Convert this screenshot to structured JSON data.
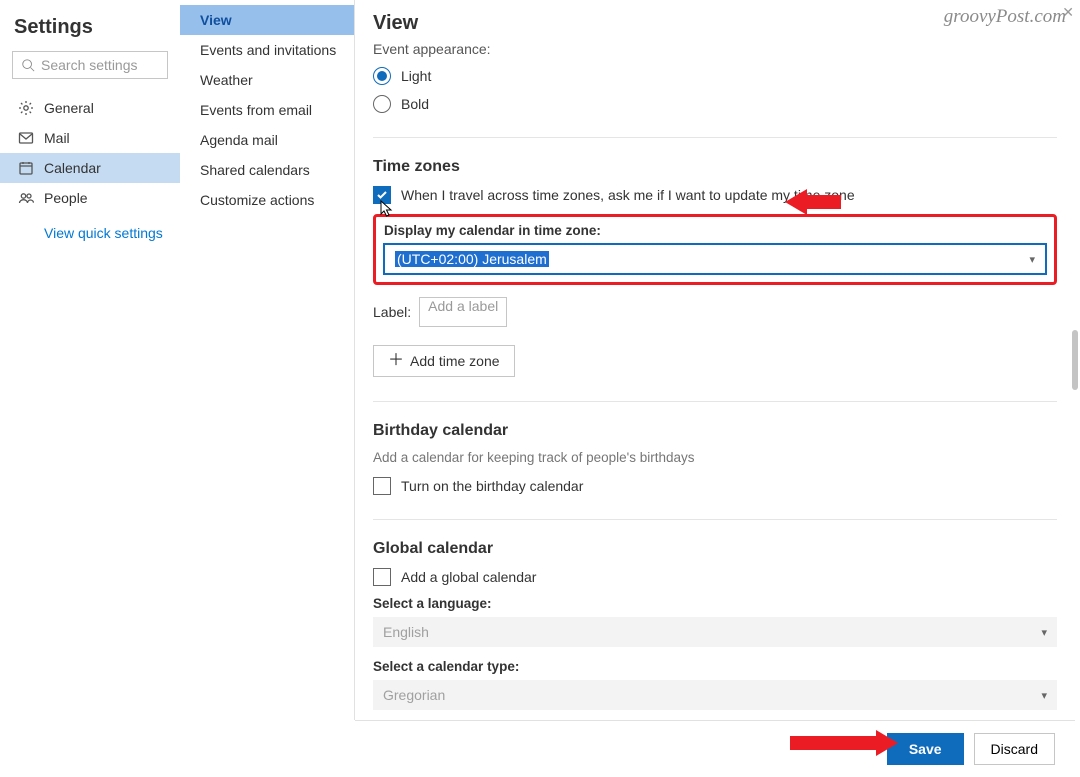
{
  "header": {
    "title": "Settings",
    "watermark": "groovyPost.com"
  },
  "search": {
    "placeholder": "Search settings"
  },
  "nav": {
    "items": [
      {
        "label": "General"
      },
      {
        "label": "Mail"
      },
      {
        "label": "Calendar"
      },
      {
        "label": "People"
      }
    ],
    "quick_link": "View quick settings"
  },
  "tabs": [
    "View",
    "Events and invitations",
    "Weather",
    "Events from email",
    "Agenda mail",
    "Shared calendars",
    "Customize actions"
  ],
  "page": {
    "title": "View",
    "event_appearance": {
      "heading": "Event appearance:",
      "opt_light": "Light",
      "opt_bold": "Bold"
    },
    "timezones": {
      "heading": "Time zones",
      "travel_check": "When I travel across time zones, ask me if I want to update my time zone",
      "display_label": "Display my calendar in time zone:",
      "tz_value": "(UTC+02:00) Jerusalem",
      "label_label": "Label:",
      "label_placeholder": "Add a label",
      "add_btn": "Add time zone"
    },
    "birthday": {
      "heading": "Birthday calendar",
      "desc": "Add a calendar for keeping track of people's birthdays",
      "check": "Turn on the birthday calendar"
    },
    "global": {
      "heading": "Global calendar",
      "check": "Add a global calendar",
      "lang_label": "Select a language:",
      "lang_value": "English",
      "type_label": "Select a calendar type:",
      "type_value": "Gregorian"
    }
  },
  "footer": {
    "save": "Save",
    "discard": "Discard"
  }
}
